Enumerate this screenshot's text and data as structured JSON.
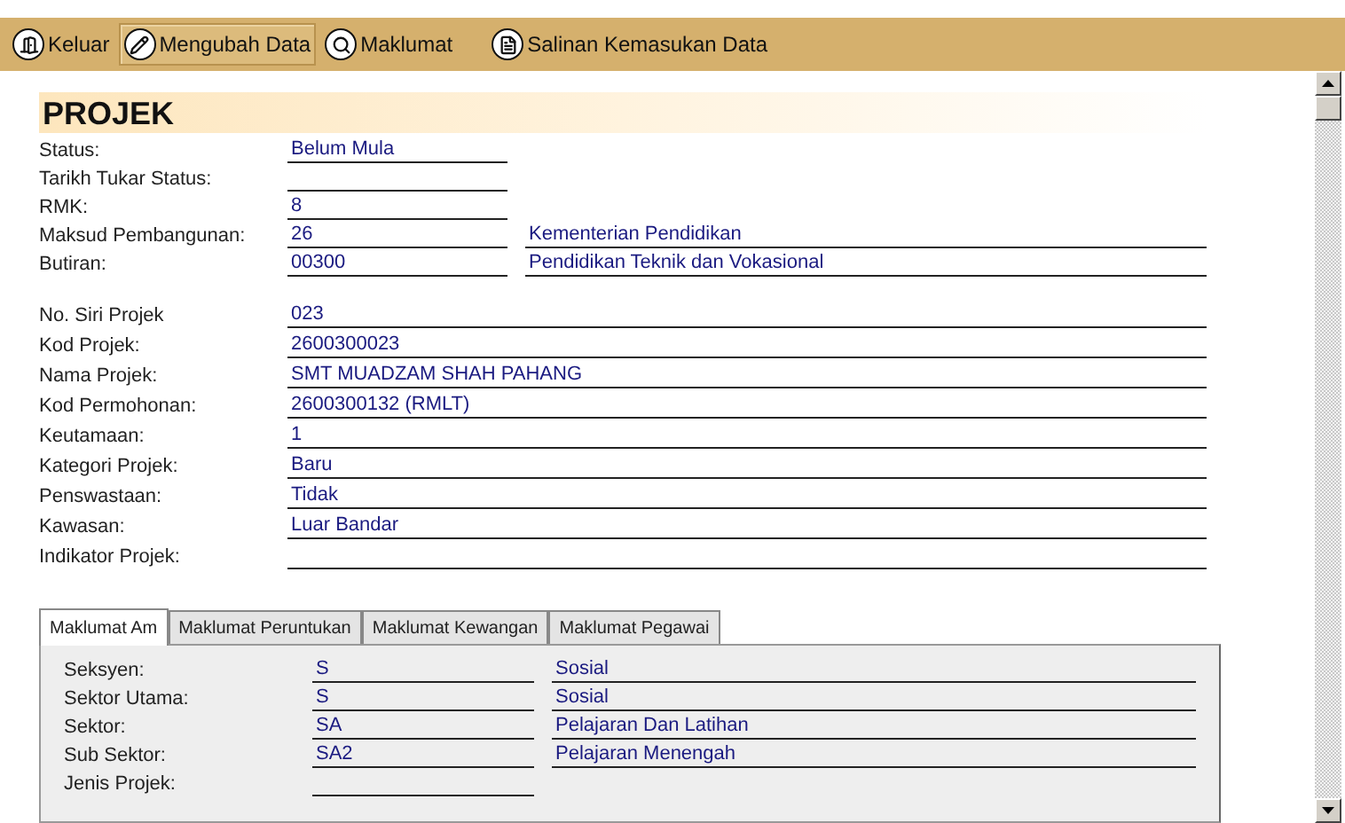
{
  "toolbar": [
    {
      "label": "Keluar",
      "kind": "exit",
      "selected": false
    },
    {
      "label": "Mengubah Data",
      "kind": "edit",
      "selected": true
    },
    {
      "label": "Maklumat",
      "kind": "info",
      "selected": false
    },
    {
      "label": "Salinan Kemasukan Data",
      "kind": "copy",
      "selected": false
    }
  ],
  "title": "PROJEK",
  "group_1": [
    {
      "label": "Status:",
      "value": "Belum Mula"
    },
    {
      "label": "Tarikh Tukar Status:"
    },
    {
      "label": "RMK:",
      "value": "8"
    },
    {
      "label": "Maksud Pembangunan:",
      "value": "26",
      "description": "Kementerian Pendidikan"
    },
    {
      "label": "Butiran:",
      "value": "00300",
      "description": "Pendidikan Teknik dan Vokasional"
    }
  ],
  "group_2": [
    {
      "label": "No. Siri Projek",
      "value": "023"
    },
    {
      "label": "Kod Projek:",
      "value": "2600300023"
    },
    {
      "label": "Nama Projek:",
      "value": "SMT MUADZAM SHAH PAHANG"
    },
    {
      "label": "Kod Permohonan:",
      "value": "2600300132 (RMLT)"
    },
    {
      "label": "Keutamaan:",
      "value": "1"
    },
    {
      "label": "Kategori Projek:",
      "value": "Baru"
    },
    {
      "label": "Penswastaan:",
      "value": "Tidak"
    },
    {
      "label": "Kawasan:",
      "value": "Luar Bandar"
    },
    {
      "label": "Indikator Projek:"
    }
  ],
  "tabs": [
    {
      "label": "Maklumat Am",
      "selected": true
    },
    {
      "label": "Maklumat Peruntukan",
      "selected": false
    },
    {
      "label": "Maklumat Kewangan",
      "selected": false
    },
    {
      "label": "Maklumat Pegawai",
      "selected": false
    }
  ],
  "tab_fields": [
    {
      "label": "Seksyen:",
      "value": "S",
      "description": "Sosial"
    },
    {
      "label": "Sektor Utama:",
      "value": "S",
      "description": "Sosial"
    },
    {
      "label": "Sektor:",
      "value": "SA",
      "description": "Pelajaran Dan Latihan"
    },
    {
      "label": "Sub Sektor:",
      "value": "SA2",
      "description": "Pelajaran Menengah"
    },
    {
      "label": "Jenis Projek:"
    }
  ]
}
